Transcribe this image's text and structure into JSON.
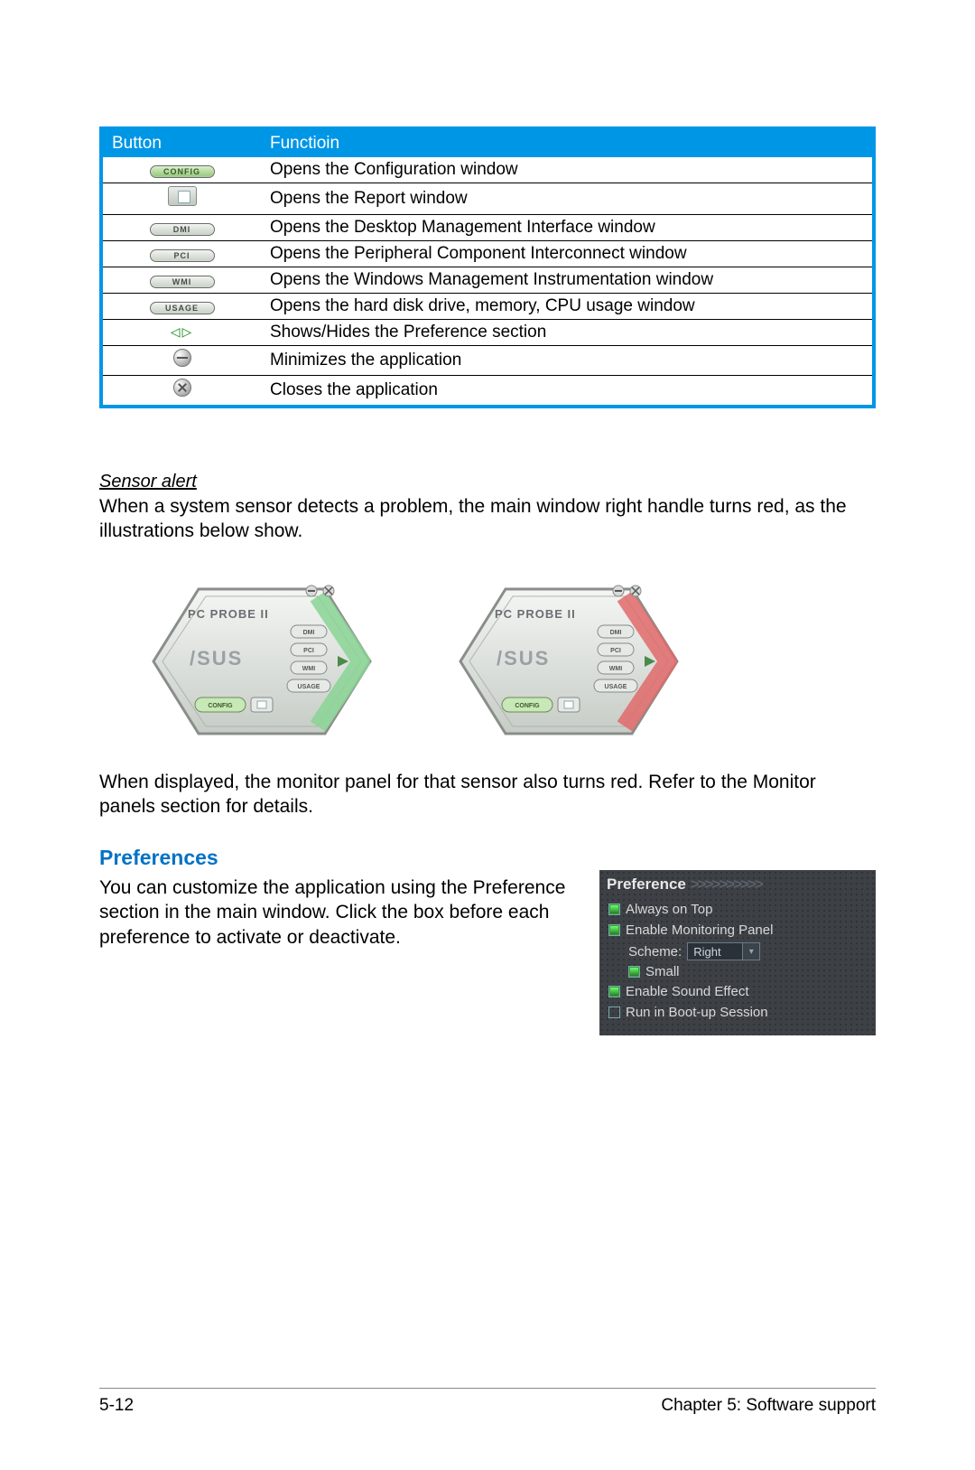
{
  "table": {
    "headers": {
      "button": "Button",
      "function": "Functioin"
    },
    "rows": [
      {
        "btn": "CONFIG",
        "desc": "Opens the Configuration window"
      },
      {
        "btn": "report",
        "desc": "Opens the Report window"
      },
      {
        "btn": "DMI",
        "desc": "Opens the Desktop Management Interface window"
      },
      {
        "btn": "PCI",
        "desc": "Opens the Peripheral Component Interconnect window"
      },
      {
        "btn": "WMI",
        "desc": "Opens the Windows Management Instrumentation window"
      },
      {
        "btn": "USAGE",
        "desc": "Opens the hard disk drive, memory, CPU usage window"
      },
      {
        "btn": "arrows",
        "desc": "Shows/Hides the Preference section"
      },
      {
        "btn": "minimize",
        "desc": "Minimizes the application"
      },
      {
        "btn": "close",
        "desc": "Closes the application"
      }
    ]
  },
  "sensor": {
    "heading": "Sensor alert",
    "p1": "When a system sensor detects a problem, the main window right handle turns red, as the illustrations below show.",
    "p2": "When displayed, the monitor panel for that sensor also turns red. Refer to the Monitor panels section for details."
  },
  "hex": {
    "title": "PC PROBE II",
    "labels": {
      "dmi": "DMI",
      "pci": "PCI",
      "wmi": "WMI",
      "usage": "USAGE",
      "config": "CONFIG"
    }
  },
  "preferences": {
    "heading": "Preferences",
    "text": "You can customize the application using the Preference section in the main window. Click the box before each preference to activate or deactivate.",
    "panel": {
      "title": "Preference",
      "items": {
        "always_on_top": "Always on Top",
        "enable_monitoring": "Enable Monitoring Panel",
        "scheme_label": "Scheme:",
        "scheme_value": "Right",
        "small": "Small",
        "enable_sound": "Enable Sound Effect",
        "run_boot": "Run in Boot-up Session"
      }
    }
  },
  "footer": {
    "page": "5-12",
    "chapter": "Chapter 5: Software support"
  }
}
